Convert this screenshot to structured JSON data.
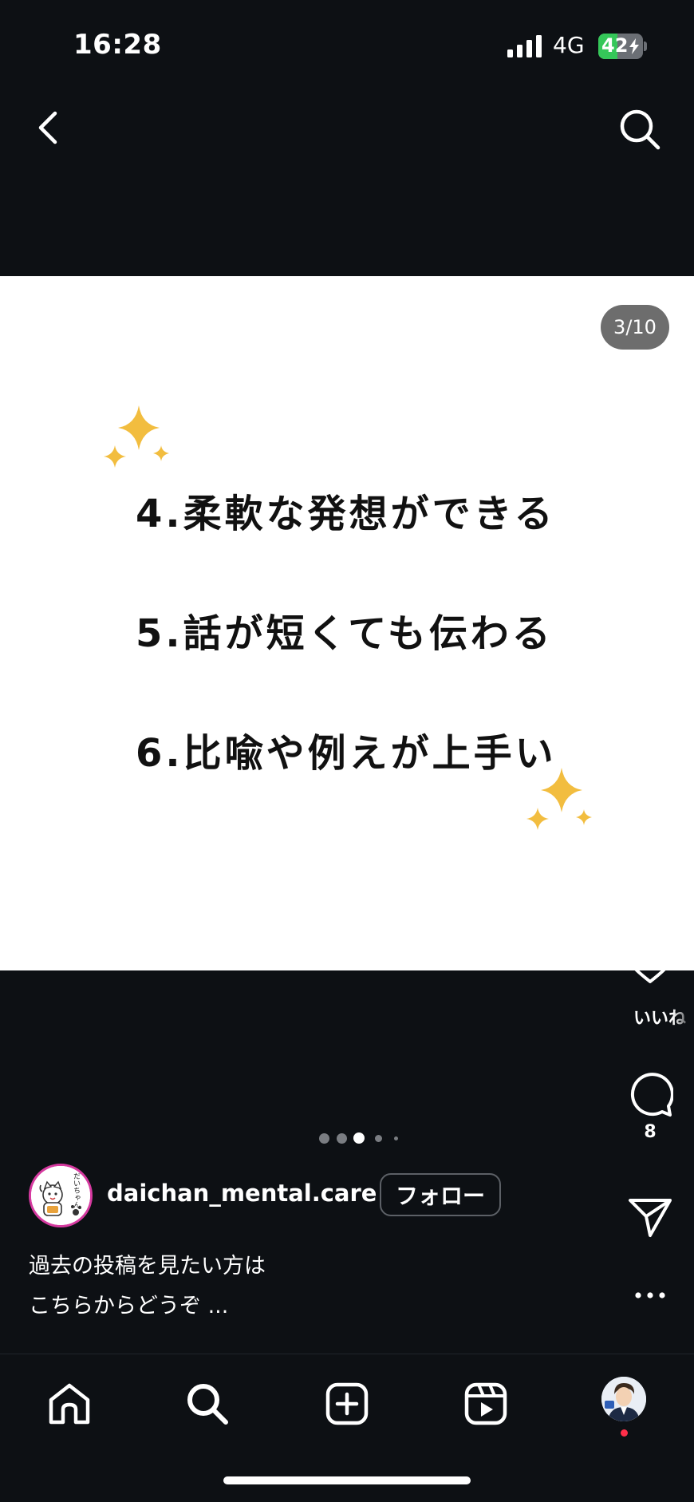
{
  "status_bar": {
    "time": "16:28",
    "network": "4G",
    "battery_percent": "42",
    "battery_level": 0.42,
    "battery_color": "#35c759"
  },
  "top_nav": {
    "back_icon": "chevron-left-icon",
    "search_icon": "search-icon"
  },
  "post": {
    "counter": "3/10",
    "lines": [
      "4.柔軟な発想ができる",
      "5.話が短くても伝わる",
      "6.比喩や例えが上手い"
    ],
    "sparkle_color": "#f2bd3f"
  },
  "actions": {
    "like_icon": "heart-icon",
    "like_label": "いいね",
    "comment_icon": "comment-icon",
    "comment_count": "8",
    "share_icon": "send-icon",
    "more_icon": "more-icon"
  },
  "carousel": {
    "dot_count": 5,
    "active_index": 2
  },
  "author": {
    "username": "daichan_mental.care",
    "follow_label": "フォロー",
    "avatar_text": "だいちゃん"
  },
  "caption": {
    "line1": "過去の投稿を見たい方は",
    "line2": "こちらからどうぞ ..."
  },
  "bottom_nav": {
    "items": [
      "home-icon",
      "search-icon",
      "create-icon",
      "reels-icon",
      "profile-avatar"
    ]
  },
  "colors": {
    "background": "#0d1014",
    "accent_follow_border": "#5c6066",
    "avatar_ring": "#d63aa0",
    "notification": "#ff2f4a"
  }
}
